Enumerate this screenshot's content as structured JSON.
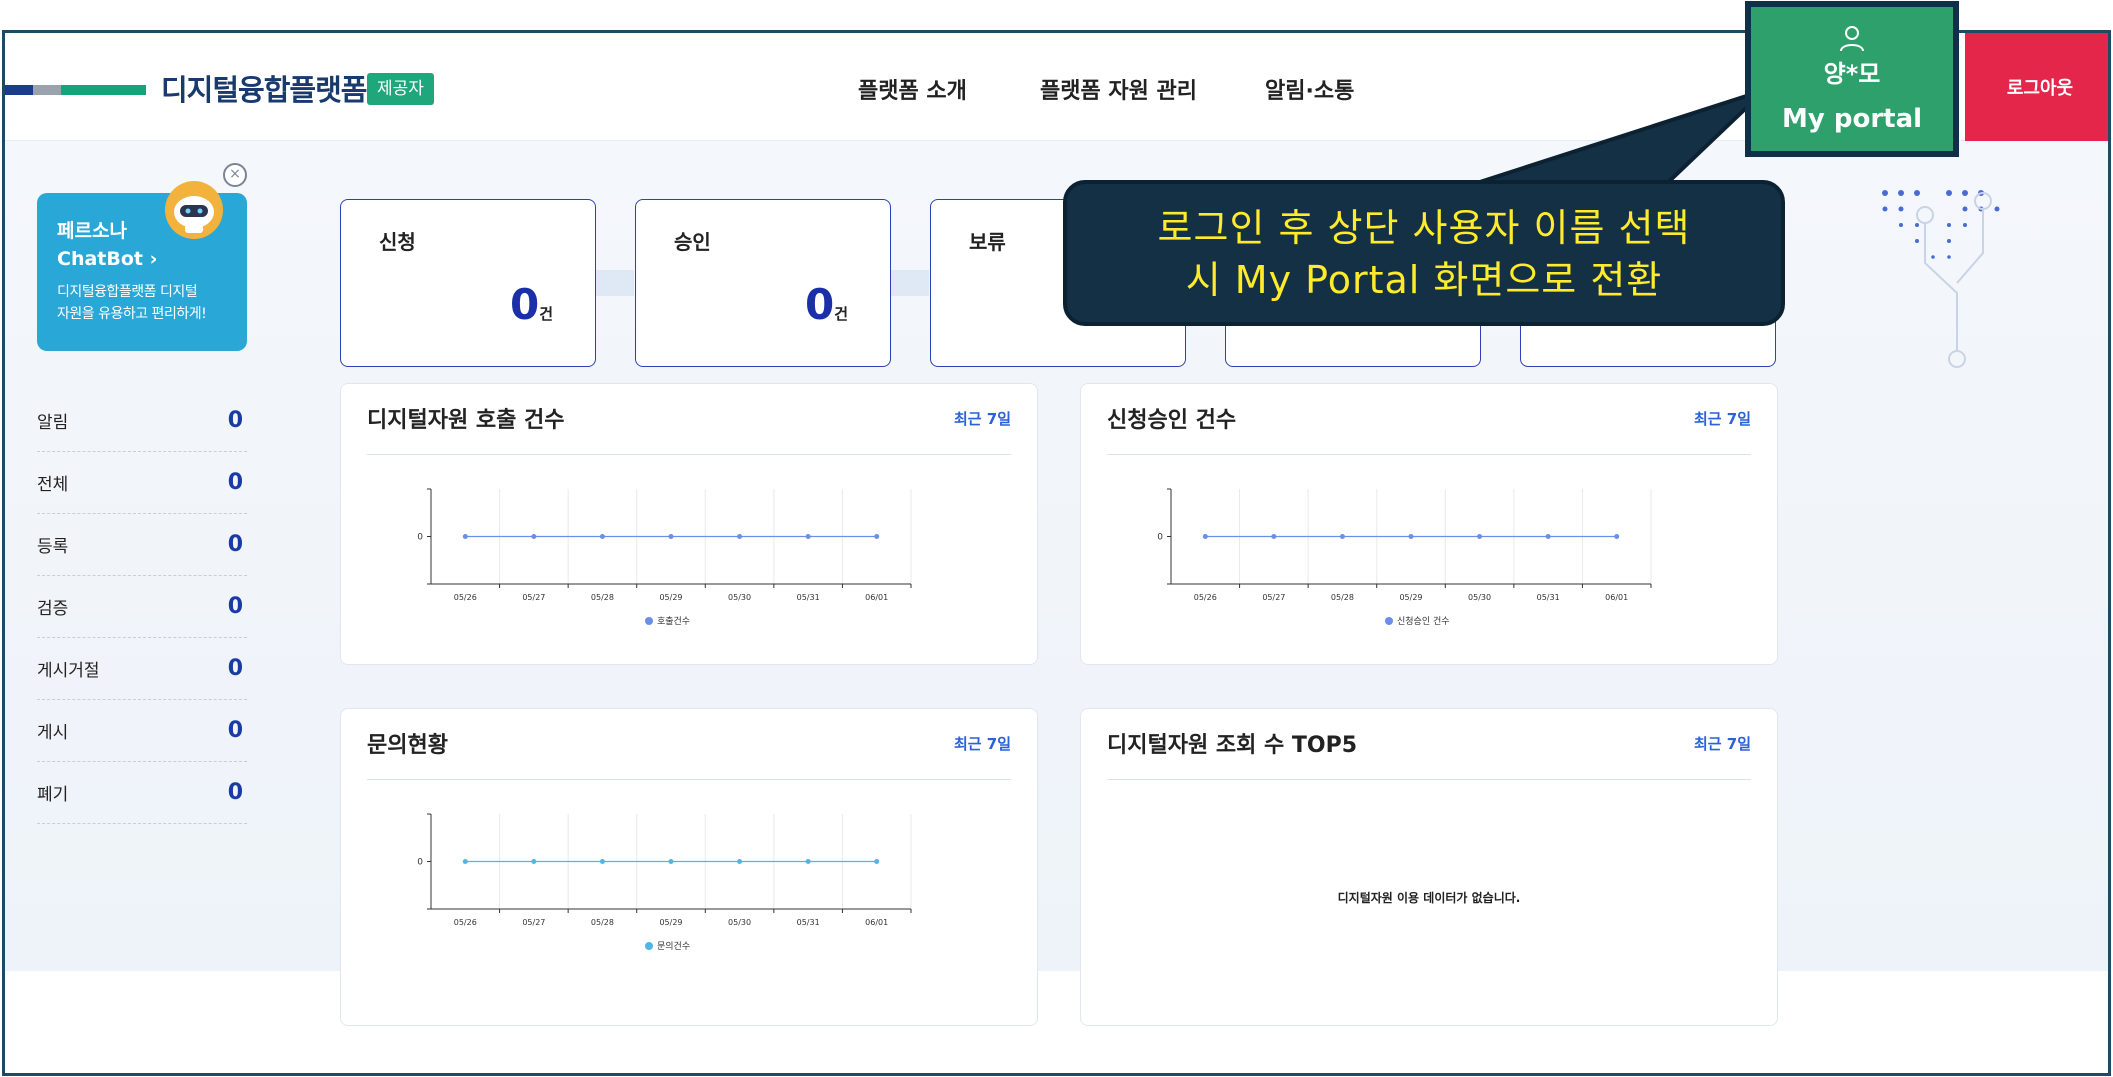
{
  "header": {
    "logo_text": "디지털융합플랫폼",
    "role_badge": "제공자",
    "nav": [
      "플랫폼 소개",
      "플랫폼 자원 관리",
      "알림·소통"
    ],
    "logout": "로그아웃",
    "logo_colors": [
      "#1b3b8c",
      "#9aa3ad",
      "#17a37a"
    ]
  },
  "portal": {
    "user_name": "양*모",
    "label": "My portal",
    "icon": "user-icon"
  },
  "callout": {
    "line1": "로그인 후 상단 사용자 이름 선택",
    "line2": "시 My Portal 화면으로 전환"
  },
  "chatbot": {
    "title1": "페르소나",
    "title2": "ChatBot",
    "desc_line1": "디지털융합플랫폼 디지털",
    "desc_line2": "자원을 유용하고 편리하게!"
  },
  "sidebar": {
    "items": [
      {
        "label": "알림",
        "count": "0"
      },
      {
        "label": "전체",
        "count": "0"
      },
      {
        "label": "등록",
        "count": "0"
      },
      {
        "label": "검증",
        "count": "0"
      },
      {
        "label": "게시거절",
        "count": "0"
      },
      {
        "label": "게시",
        "count": "0"
      },
      {
        "label": "폐기",
        "count": "0"
      }
    ]
  },
  "status": [
    {
      "label": "신청",
      "value": "0",
      "unit": "건"
    },
    {
      "label": "승인",
      "value": "0",
      "unit": "건"
    },
    {
      "label": "보류",
      "value": "",
      "unit": ""
    },
    {
      "label": "",
      "value": "",
      "unit": ""
    },
    {
      "label": "",
      "value": "",
      "unit": ""
    }
  ],
  "panels": {
    "calls": {
      "title": "디지털자원 호출 건수",
      "period": "최근 7일"
    },
    "approvals": {
      "title": "신청승인 건수",
      "period": "최근 7일"
    },
    "inquiries": {
      "title": "문의현황",
      "period": "최근 7일"
    },
    "top5": {
      "title": "디지털자원 조회 수 TOP5",
      "period": "최근 7일",
      "empty_message": "디지털자원 이용 데이터가 없습니다."
    }
  },
  "chart_data": [
    {
      "type": "line",
      "categories": [
        "05/26",
        "05/27",
        "05/28",
        "05/29",
        "05/30",
        "05/31",
        "06/01"
      ],
      "series": [
        {
          "name": "호출건수",
          "values": [
            0,
            0,
            0,
            0,
            0,
            0,
            0
          ],
          "color": "#6a8fe8"
        }
      ],
      "y_ticks": [
        "0"
      ],
      "legend": "bottom"
    },
    {
      "type": "line",
      "categories": [
        "05/26",
        "05/27",
        "05/28",
        "05/29",
        "05/30",
        "05/31",
        "06/01"
      ],
      "series": [
        {
          "name": "신청승인 건수",
          "values": [
            0,
            0,
            0,
            0,
            0,
            0,
            0
          ],
          "color": "#6a8fe8"
        }
      ],
      "y_ticks": [
        "0"
      ],
      "legend": "bottom"
    },
    {
      "type": "line",
      "categories": [
        "05/26",
        "05/27",
        "05/28",
        "05/29",
        "05/30",
        "05/31",
        "06/01"
      ],
      "series": [
        {
          "name": "문의건수",
          "values": [
            0,
            0,
            0,
            0,
            0,
            0,
            0
          ],
          "color": "#4fb6ea"
        }
      ],
      "y_ticks": [
        "0"
      ],
      "legend": "bottom"
    }
  ]
}
